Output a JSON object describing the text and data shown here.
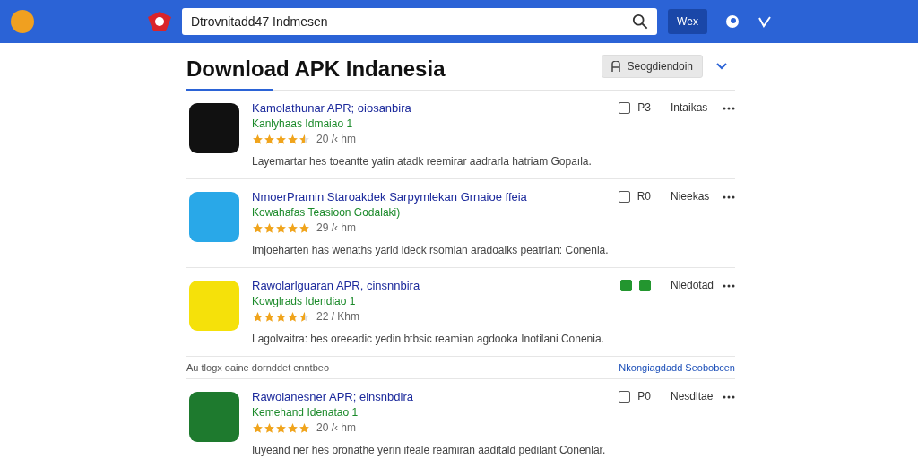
{
  "header": {
    "search": {
      "value": "Dtrovnitadd47 Indmesen"
    },
    "button": "Wex"
  },
  "page": {
    "title": "Download APK Indanesia",
    "filter_button": "Seogdiendoin"
  },
  "apps": [
    {
      "title": "Kamolathunar APR; oiosanbira",
      "subtitle": "Kanlyhaas Idmaiao 1",
      "stars": 4.5,
      "meta": "20 /‹ hm",
      "description": "Layemartar hes toeantte yatin atadk reemirar aadrarla hatriam Gopaıla.",
      "checked": false,
      "code": "P3",
      "status": "Intaikas",
      "color": "#111111"
    },
    {
      "title": "NmoerPramin  Staroakdek Sarpymlekan Grnaioe ffeia",
      "subtitle": "Kowahafas Teasioon  Godalaki)",
      "stars": 5,
      "meta": "29 /‹ hm",
      "description": "Imjoeharten has wenaths yarid ideck rsomian aradoaiks peatrian: Conenla.",
      "checked": false,
      "code": "R0",
      "status": "Nieekas",
      "color": "#29a8e8"
    },
    {
      "title": "Rawolarlguaran APR, cinsnnbira",
      "subtitle": "Kowglrads Idendiao 1",
      "stars": 4.5,
      "meta": "22 / Khm",
      "description": "Lagolvaitra: hes oreeadic yedin btbsic reamian agdooka Inotilani Conenia.",
      "checked": true,
      "status": "Nledotad",
      "color": "#f5e10a"
    }
  ],
  "list_footer": {
    "text": "Au tlogx oaine dornddet enntbeo",
    "link": "Nkongiagdadd Seobobcen"
  },
  "apps_more": [
    {
      "title": "Rawolanesner APR; einsnbdira",
      "subtitle": "Kemehand Idenatao 1",
      "stars": 5,
      "meta": "20 /‹ hm",
      "description": "Iuyeand ner hes oronathe yerin ifeale reamiran aaditald pedilant Conenlar.",
      "checked": false,
      "code": "P0",
      "status": "Nesdltae",
      "color": "#1e7a2e"
    }
  ]
}
